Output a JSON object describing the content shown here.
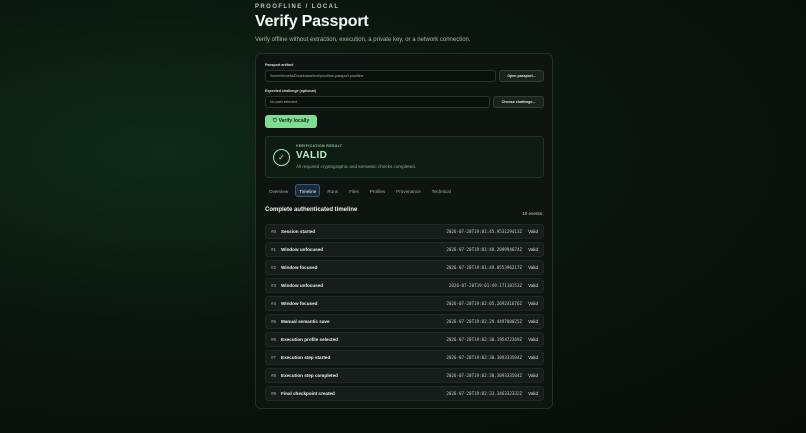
{
  "header": {
    "eyebrow": "PROOFLINE / LOCAL",
    "title": "Verify Passport",
    "subtitle": "Verify offline without extraction, execution, a private key, or a network connection."
  },
  "form": {
    "artifact_label": "Passport artifact",
    "artifact_value": "/home/revsella/Downloads/test/proofline-passport.proofline",
    "open_button": "Open passport...",
    "challenge_label": "Expected challenge (optional)",
    "challenge_value": "No path selected",
    "choose_button": "Choose challenge...",
    "verify_button": "Verify locally",
    "verify_icon": "shield-icon"
  },
  "result": {
    "tag": "VERIFICATION RESULT",
    "status": "VALID",
    "description": "All required cryptographic and semantic checks completed.",
    "icon": "check-icon",
    "color": "#b8f0c3"
  },
  "tabs": [
    "Overview",
    "Timeline",
    "Runs",
    "Files",
    "Profiles",
    "Provenance",
    "Technical"
  ],
  "active_tab": "Timeline",
  "timeline": {
    "title": "Complete authenticated timeline",
    "count": "10 events",
    "events": [
      {
        "idx": "#0",
        "name": "Session started",
        "ts": "2026-07-20T19:01:45.953129413Z",
        "status": "Valid"
      },
      {
        "idx": "#1",
        "name": "Window unfocused",
        "ts": "2026-07-20T19:01:48.209994674Z",
        "status": "Valid"
      },
      {
        "idx": "#2",
        "name": "Window focused",
        "ts": "2026-07-20T19:01:49.055396217Z",
        "status": "Valid"
      },
      {
        "idx": "#3",
        "name": "Window unfocused",
        "ts": "2026-07-20T19:01:49.17118153Z",
        "status": "Valid"
      },
      {
        "idx": "#4",
        "name": "Window focused",
        "ts": "2026-07-20T19:02:05.269241676Z",
        "status": "Valid"
      },
      {
        "idx": "#5",
        "name": "Manual semantic save",
        "ts": "2026-07-20T19:02:29.449700025Z",
        "status": "Valid"
      },
      {
        "idx": "#6",
        "name": "Execution profile selected",
        "ts": "2026-07-20T19:02:30.195472369Z",
        "status": "Valid"
      },
      {
        "idx": "#7",
        "name": "Execution step started",
        "ts": "2026-07-20T19:02:30.309333504Z",
        "status": "Valid"
      },
      {
        "idx": "#8",
        "name": "Execution step completed",
        "ts": "2026-07-20T19:02:30.309333504Z",
        "status": "Valid"
      },
      {
        "idx": "#9",
        "name": "Final checkpoint created",
        "ts": "2026-07-20T19:02:33.346332332Z",
        "status": "Valid"
      }
    ]
  }
}
